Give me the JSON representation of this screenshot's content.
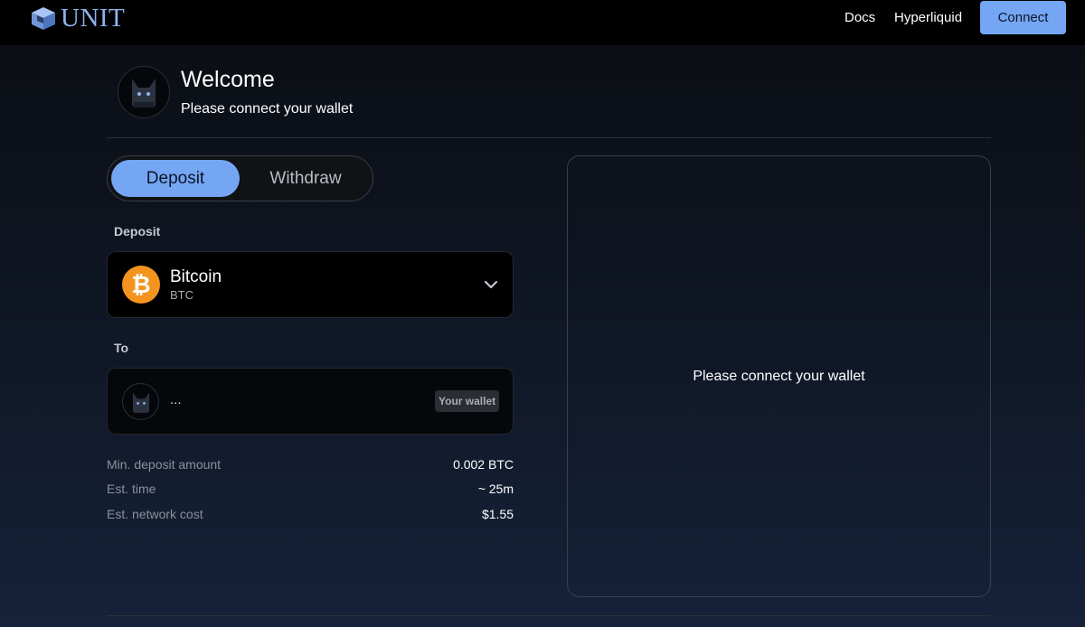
{
  "header": {
    "logo_text": "UNIT",
    "nav": {
      "docs": "Docs",
      "hyperliquid": "Hyperliquid"
    },
    "connect_label": "Connect"
  },
  "welcome": {
    "title": "Welcome",
    "subtitle": "Please connect your wallet"
  },
  "toggle": {
    "deposit": "Deposit",
    "withdraw": "Withdraw",
    "active": "Deposit"
  },
  "deposit_section": {
    "label": "Deposit",
    "asset_name": "Bitcoin",
    "asset_symbol": "BTC",
    "asset_icon_glyph": "₿"
  },
  "to_section": {
    "label": "To",
    "address": "...",
    "badge": "Your wallet"
  },
  "info": [
    {
      "label": "Min. deposit amount",
      "value": "0.002 BTC"
    },
    {
      "label": "Est. time",
      "value": "~ 25m"
    },
    {
      "label": "Est. network cost",
      "value": "$1.55"
    }
  ],
  "panel": {
    "message": "Please connect your wallet"
  },
  "colors": {
    "accent": "#74a6f4",
    "bitcoin": "#f3941f",
    "logo": "#8fb2ee"
  }
}
